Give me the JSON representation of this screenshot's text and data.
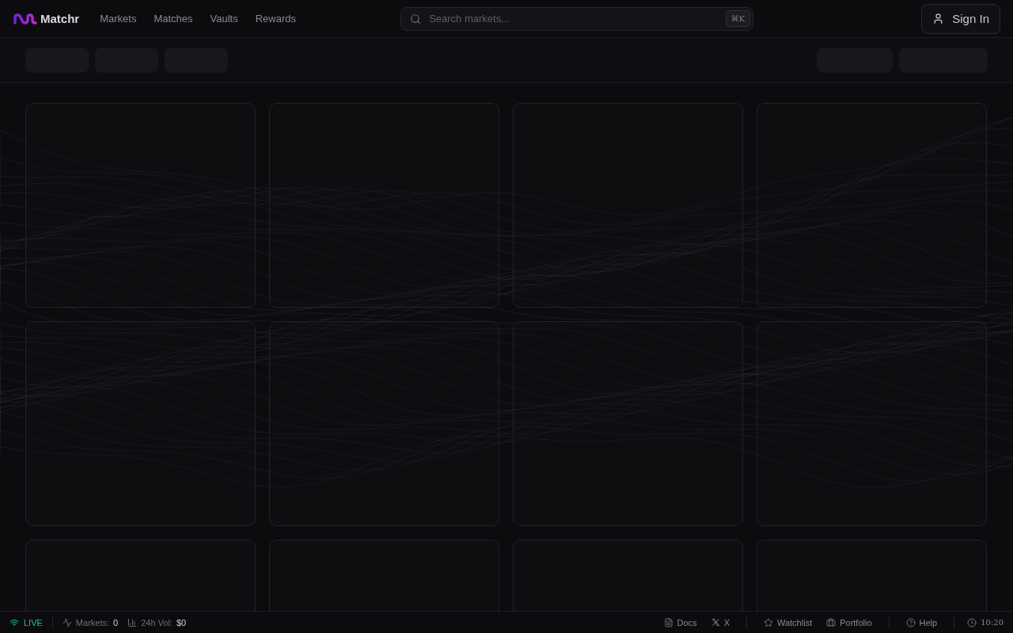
{
  "brand": {
    "name": "Matchr"
  },
  "nav": [
    {
      "label": "Markets"
    },
    {
      "label": "Matches"
    },
    {
      "label": "Vaults"
    },
    {
      "label": "Rewards"
    }
  ],
  "search": {
    "placeholder": "Search markets...",
    "shortcut": "⌘K"
  },
  "sign_in": {
    "label": "Sign In"
  },
  "toolbar": {
    "left": [
      {
        "kind": "skeleton"
      },
      {
        "kind": "skeleton"
      },
      {
        "kind": "skeleton"
      }
    ],
    "right": [
      {
        "kind": "skeleton"
      },
      {
        "kind": "skeleton-wide"
      }
    ]
  },
  "cards": [
    {
      "kind": "skeleton"
    },
    {
      "kind": "skeleton"
    },
    {
      "kind": "skeleton"
    },
    {
      "kind": "skeleton"
    },
    {
      "kind": "skeleton"
    },
    {
      "kind": "skeleton"
    },
    {
      "kind": "skeleton"
    },
    {
      "kind": "skeleton"
    },
    {
      "kind": "skeleton"
    },
    {
      "kind": "skeleton"
    },
    {
      "kind": "skeleton"
    },
    {
      "kind": "skeleton"
    }
  ],
  "status_bar": {
    "live": "LIVE",
    "stats": [
      {
        "kind": "activity",
        "label": "Markets:",
        "value": "0"
      },
      {
        "kind": "chart",
        "label": "24h Vol:",
        "value": "$0"
      }
    ],
    "links": [
      {
        "kind": "doc",
        "label": "Docs"
      },
      {
        "kind": "x",
        "label": "X"
      },
      {
        "kind": "divider"
      },
      {
        "kind": "star",
        "label": "Watchlist"
      },
      {
        "kind": "briefcase",
        "label": "Portfolio"
      },
      {
        "kind": "divider"
      },
      {
        "kind": "help",
        "label": "Help"
      },
      {
        "kind": "divider"
      },
      {
        "kind": "clock",
        "label": "10:20"
      }
    ]
  }
}
